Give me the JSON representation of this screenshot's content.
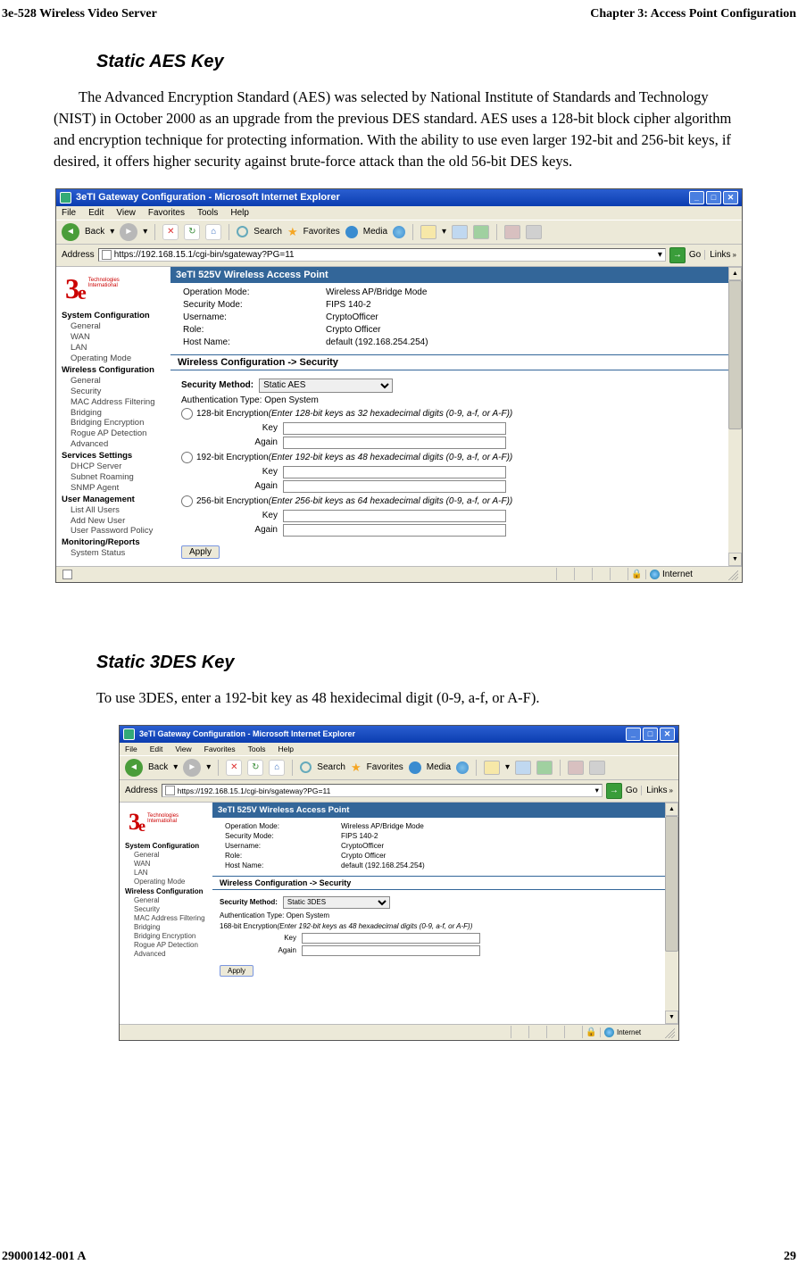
{
  "header": {
    "left": "3e-528 Wireless Video Server",
    "right": "Chapter 3: Access Point Configuration"
  },
  "footer": {
    "left": "29000142-001 A",
    "right": "29"
  },
  "sections": {
    "aes_title": "Static AES Key",
    "aes_body": "The Advanced Encryption Standard (AES) was selected by National Institute of Standards and Technology (NIST) in October 2000 as an upgrade from the previous DES standard.  AES uses a 128-bit block cipher algorithm and encryption technique for protecting information.  With the ability to use even larger 192-bit and 256-bit keys, if desired, it offers higher security against brute-force attack than the old 56-bit DES keys.",
    "tdes_title": "Static 3DES Key",
    "tdes_body": "To use 3DES, enter a 192-bit key as 48 hexidecimal digit (0-9, a-f, or A-F)."
  },
  "browser_common": {
    "title": "3eTI Gateway Configuration - Microsoft Internet Explorer",
    "menu": {
      "file": "File",
      "edit": "Edit",
      "view": "View",
      "favorites": "Favorites",
      "tools": "Tools",
      "help": "Help"
    },
    "toolbar": {
      "back": "Back",
      "search": "Search",
      "favorites": "Favorites",
      "media": "Media"
    },
    "addressbar": {
      "label": "Address",
      "url": "https://192.168.15.1/cgi-bin/sgateway?PG=11",
      "go": "Go",
      "links": "Links"
    },
    "logo": {
      "small1": "Technologies",
      "small2": "International"
    },
    "nav": {
      "g1": "System Configuration",
      "g1_items": [
        "General",
        "WAN",
        "LAN",
        "Operating Mode"
      ],
      "g2": "Wireless Configuration",
      "g2_items": [
        "General",
        "Security",
        "MAC Address Filtering",
        "Bridging",
        "Bridging Encryption",
        "Rogue AP Detection",
        "Advanced"
      ],
      "g3": "Services Settings",
      "g3_items": [
        "DHCP Server",
        "Subnet Roaming",
        "SNMP Agent"
      ],
      "g4": "User Management",
      "g4_items": [
        "List All Users",
        "Add New User",
        "User Password Policy"
      ],
      "g5": "Monitoring/Reports",
      "g5_items": [
        "System Status"
      ]
    },
    "main": {
      "title": "3eTI 525V Wireless Access Point",
      "info": {
        "k1": "Operation Mode:",
        "v1": "Wireless AP/Bridge Mode",
        "k2": "Security Mode:",
        "v2": "FIPS 140-2",
        "k3": "Username:",
        "v3": "CryptoOfficer",
        "k4": "Role:",
        "v4": "Crypto Officer",
        "k5": "Host Name:",
        "v5": "default (192.168.254.254)"
      },
      "sect": "Wireless Configuration -> Security",
      "sec_method_label": "Security Method:",
      "auth_line": "Authentication Type: Open System",
      "key_label": "Key",
      "again_label": "Again",
      "apply": "Apply"
    },
    "status": {
      "internet": "Internet"
    }
  },
  "aes_screen": {
    "dropdown_value": "Static AES",
    "opt128": "128-bit Encryption ",
    "opt128_hint": "(Enter 128-bit keys as 32 hexadecimal digits (0-9, a-f, or A-F))",
    "opt192": "192-bit Encryption ",
    "opt192_hint": "(Enter 192-bit keys as 48 hexadecimal digits (0-9, a-f, or A-F))",
    "opt256": "256-bit Encryption ",
    "opt256_hint": "(Enter 256-bit keys as 64 hexadecimal digits (0-9, a-f, or A-F))"
  },
  "tdes_screen": {
    "dropdown_value": "Static 3DES",
    "line": "168-bit Encryption ",
    "line_hint": "(Enter 192-bit keys as 48 hexadecimal digits (0-9, a-f, or A-F))"
  }
}
